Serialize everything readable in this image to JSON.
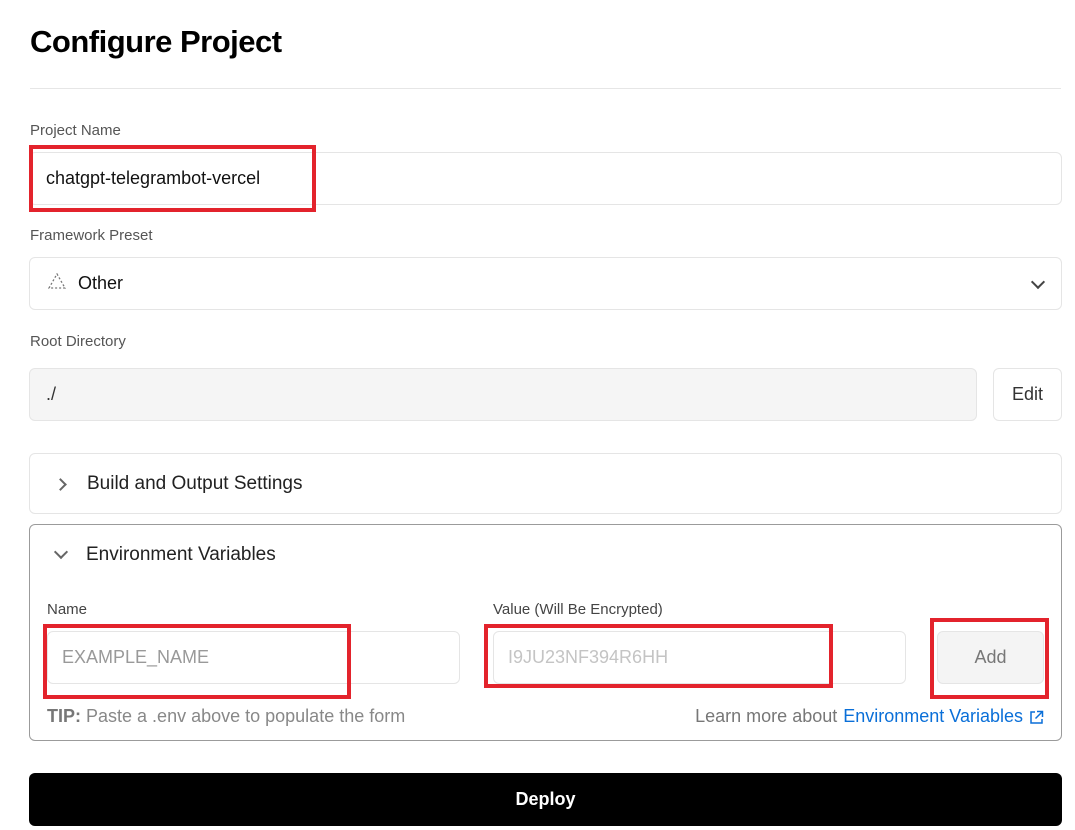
{
  "page": {
    "title": "Configure Project"
  },
  "project_name": {
    "label": "Project Name",
    "value": "chatgpt-telegrambot-vercel"
  },
  "framework_preset": {
    "label": "Framework Preset",
    "value": "Other",
    "icon": "triangle-outline-icon"
  },
  "root_directory": {
    "label": "Root Directory",
    "value": "./",
    "edit_label": "Edit"
  },
  "build_settings": {
    "label": "Build and Output Settings",
    "expanded": false
  },
  "env_vars": {
    "label": "Environment Variables",
    "expanded": true,
    "name_label": "Name",
    "name_placeholder": "EXAMPLE_NAME",
    "value_label": "Value (Will Be Encrypted)",
    "value_placeholder": "I9JU23NF394R6HH",
    "add_label": "Add",
    "tip_prefix": "TIP:",
    "tip_text": "Paste a .env above to populate the form",
    "learn_more_text": "Learn more about",
    "learn_more_link": "Environment Variables"
  },
  "deploy": {
    "label": "Deploy"
  },
  "colors": {
    "highlight": "#e3232c",
    "link": "#0a6fd8",
    "deploy_bg": "#000000"
  }
}
